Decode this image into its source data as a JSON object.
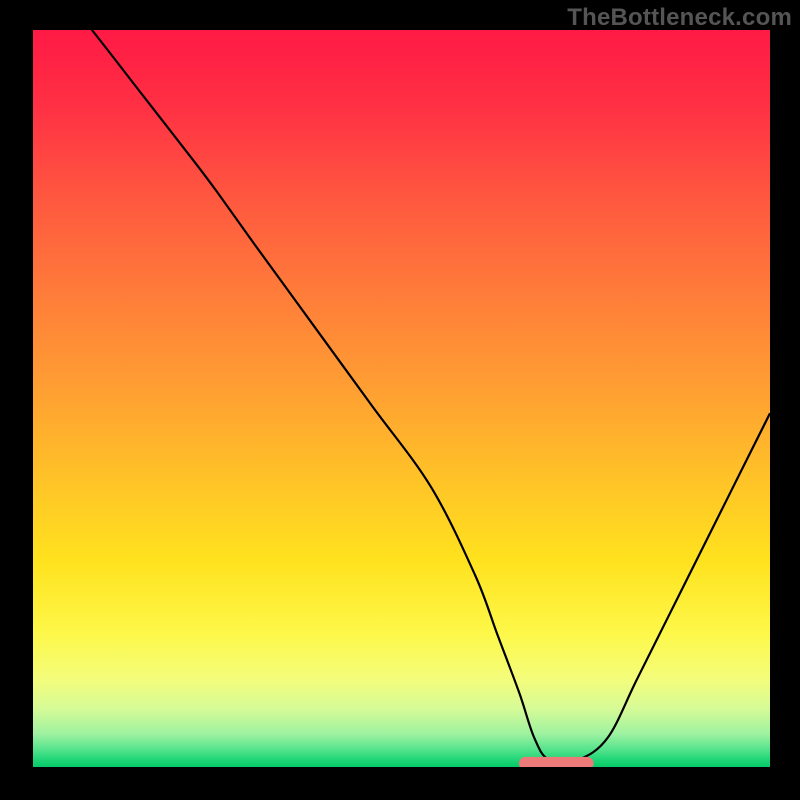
{
  "watermark": "TheBottleneck.com",
  "chart_data": {
    "type": "line",
    "title": "",
    "xlabel": "",
    "ylabel": "",
    "xlim": [
      0,
      100
    ],
    "ylim": [
      0,
      100
    ],
    "x": [
      0,
      8,
      15,
      22,
      25,
      30,
      38,
      46,
      54,
      60,
      63,
      66,
      68,
      70,
      74,
      78,
      82,
      88,
      94,
      100
    ],
    "values": [
      110,
      100,
      91,
      82,
      78,
      71,
      60,
      49,
      38,
      26,
      18,
      10,
      4,
      1,
      1,
      4,
      12,
      24,
      36,
      48
    ],
    "optimal_zone": {
      "x_start": 66,
      "x_end": 76,
      "y": 0.5
    },
    "background_gradient": [
      {
        "offset": 0.0,
        "color": "#ff1a45"
      },
      {
        "offset": 0.1,
        "color": "#ff2f44"
      },
      {
        "offset": 0.22,
        "color": "#ff5540"
      },
      {
        "offset": 0.35,
        "color": "#ff7a3a"
      },
      {
        "offset": 0.48,
        "color": "#ff9d33"
      },
      {
        "offset": 0.6,
        "color": "#ffc028"
      },
      {
        "offset": 0.72,
        "color": "#ffe21e"
      },
      {
        "offset": 0.82,
        "color": "#fdf84a"
      },
      {
        "offset": 0.88,
        "color": "#f4fd7a"
      },
      {
        "offset": 0.92,
        "color": "#d7fb96"
      },
      {
        "offset": 0.955,
        "color": "#9ef2a0"
      },
      {
        "offset": 0.975,
        "color": "#5ae48e"
      },
      {
        "offset": 0.99,
        "color": "#1fd676"
      },
      {
        "offset": 1.0,
        "color": "#06c968"
      }
    ]
  }
}
